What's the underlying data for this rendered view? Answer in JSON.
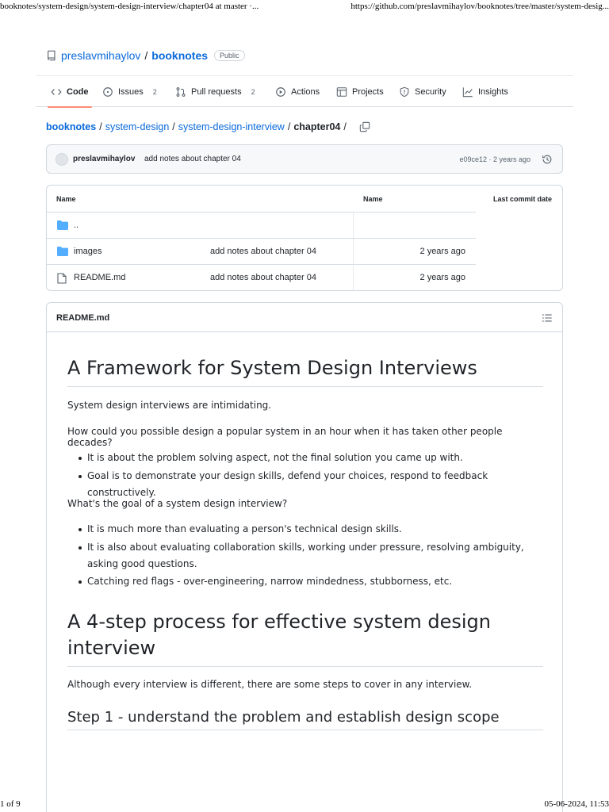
{
  "print": {
    "header_left": "booknotes/system-design/system-design-interview/chapter04 at master ·...",
    "header_right": "https://github.com/preslavmihaylov/booknotes/tree/master/system-desig...",
    "footer_left": "1 of 9",
    "footer_right": "05-06-2024, 11:53"
  },
  "repo": {
    "owner": "preslavmihaylov",
    "separator": "/",
    "name": "booknotes",
    "visibility": "Public"
  },
  "nav": {
    "code": "Code",
    "issues": "Issues",
    "issues_count": "2",
    "pulls": "Pull requests",
    "pulls_count": "2",
    "actions": "Actions",
    "projects": "Projects",
    "security": "Security",
    "insights": "Insights"
  },
  "breadcrumb": {
    "root": "booknotes",
    "items": [
      "system-design",
      "system-design-interview"
    ],
    "current": "chapter04",
    "sep": "/"
  },
  "commit": {
    "author": "preslavmihaylov",
    "message": "add notes about chapter 04",
    "meta": "e09ce12 · 2 years ago"
  },
  "files": {
    "headers": [
      "Name",
      "Name",
      "Last commit date"
    ],
    "rows": [
      {
        "icon": "folder-icon",
        "name": "..",
        "message": "",
        "date": ""
      },
      {
        "icon": "folder-icon",
        "name": "images",
        "message": "add notes about chapter 04",
        "date": "2 years ago"
      },
      {
        "icon": "file-icon",
        "name": "README.md",
        "message": "add notes about chapter 04",
        "date": "2 years ago"
      }
    ]
  },
  "readme": {
    "title": "README.md",
    "h1_framework": "A Framework for System Design Interviews",
    "p_intimidating": "System design interviews are intimidating.",
    "p_how": "How could you possible design a popular system in an hour when it has taken other people decades?",
    "list1": [
      "It is about the problem solving aspect, not the final solution you came up with.",
      "Goal is to demonstrate your design skills, defend your choices, respond to feedback constructively."
    ],
    "p_goal": "What's the goal of a system design interview?",
    "list2": [
      "It is much more than evaluating a person's technical design skills.",
      "It is also about evaluating collaboration skills, working under pressure, resolving ambiguity, asking good questions.",
      "Catching red flags - over-engineering, narrow mindedness, stubborness, etc."
    ],
    "h1_process": "A 4-step process for effective system design interview",
    "p_although": "Although every interview is different, there are some steps to cover in any interview.",
    "h2_step1": "Step 1 - understand the problem and establish design scope"
  },
  "colors": {
    "link": "#0969da",
    "folder": "#54aeff",
    "border": "#d0d7de",
    "active_tab": "#fd8c73"
  }
}
